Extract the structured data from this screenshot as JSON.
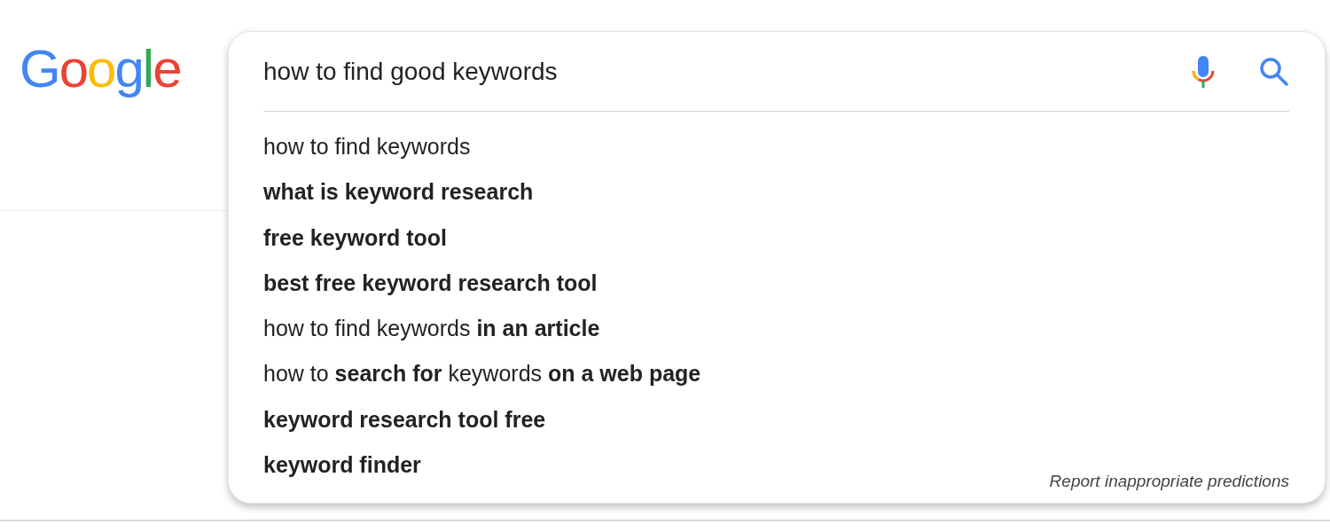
{
  "logo": "Google",
  "search": {
    "value": "how to find good keywords"
  },
  "suggestions": [
    "how to find keywords",
    "**what is keyword research**",
    "**free keyword tool**",
    "**best free keyword research tool**",
    "how to find keywords **in an article**",
    "how to **search for** keywords **on a web page**",
    "**keyword research tool free**",
    "**keyword finder**"
  ],
  "report_link": "Report inappropriate predictions"
}
